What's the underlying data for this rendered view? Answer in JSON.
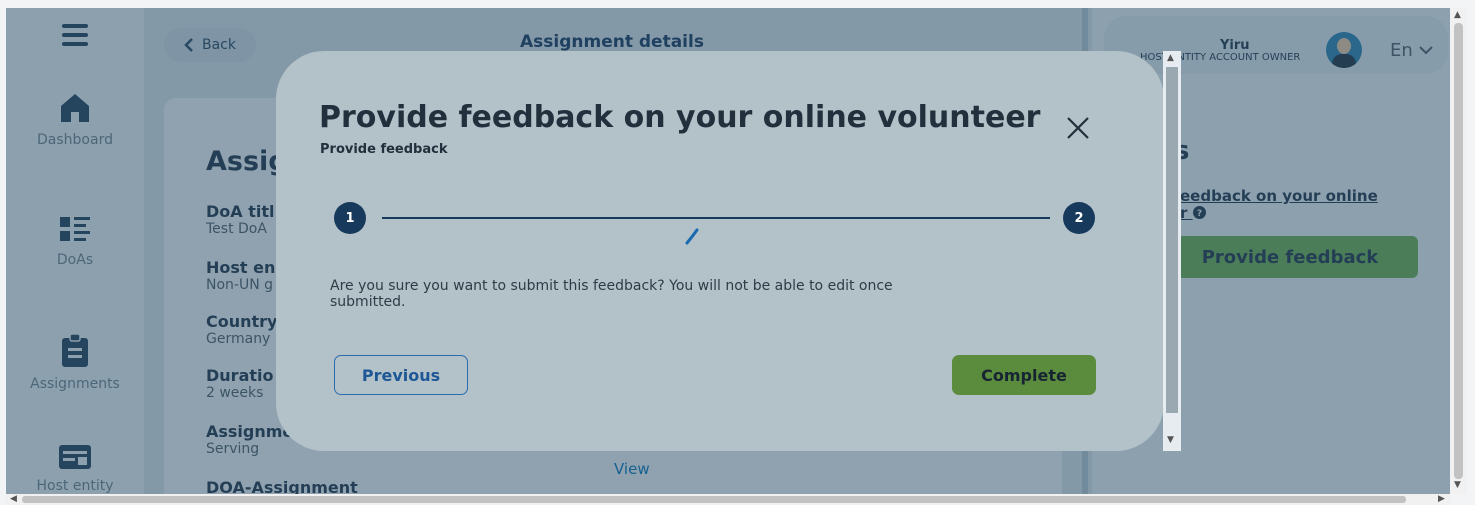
{
  "header": {
    "back_label": "Back",
    "title": "Assignment details"
  },
  "sidebar": {
    "items": [
      {
        "label": "Dashboard",
        "icon": "home-icon"
      },
      {
        "label": "DoAs",
        "icon": "list-icon"
      },
      {
        "label": "Assignments",
        "icon": "clipboard-icon"
      },
      {
        "label": "Host entity",
        "icon": "id-card-icon"
      }
    ]
  },
  "main": {
    "heading": "Assig",
    "fields": [
      {
        "label": "DoA titl",
        "value": "Test DoA"
      },
      {
        "label": "Host en",
        "value": "Non-UN g"
      },
      {
        "label": "Country",
        "value": "Germany"
      },
      {
        "label": "Duratio",
        "value": "2 weeks"
      },
      {
        "label": "Assignme",
        "value": "Serving"
      },
      {
        "label": "DOA-Assignment",
        "value": ""
      }
    ],
    "view_link": "View"
  },
  "user": {
    "name": "Yiru",
    "role": "HOST ENTITY ACCOUNT OWNER",
    "language": "En"
  },
  "right_panel": {
    "heading": "s",
    "feedback_link": "eedback on your online r",
    "feedback_button": "Provide feedback"
  },
  "modal": {
    "title": "Provide feedback on your online volunteer",
    "subtitle": "Provide feedback",
    "steps": [
      "1",
      "2"
    ],
    "message": "Are you sure you want to submit this feedback? You will not be able to edit once submitted.",
    "previous_label": "Previous",
    "complete_label": "Complete"
  },
  "colors": {
    "primary_navy": "#173a5c",
    "accent_green": "#5b8c3e",
    "link_blue": "#1e5795"
  }
}
